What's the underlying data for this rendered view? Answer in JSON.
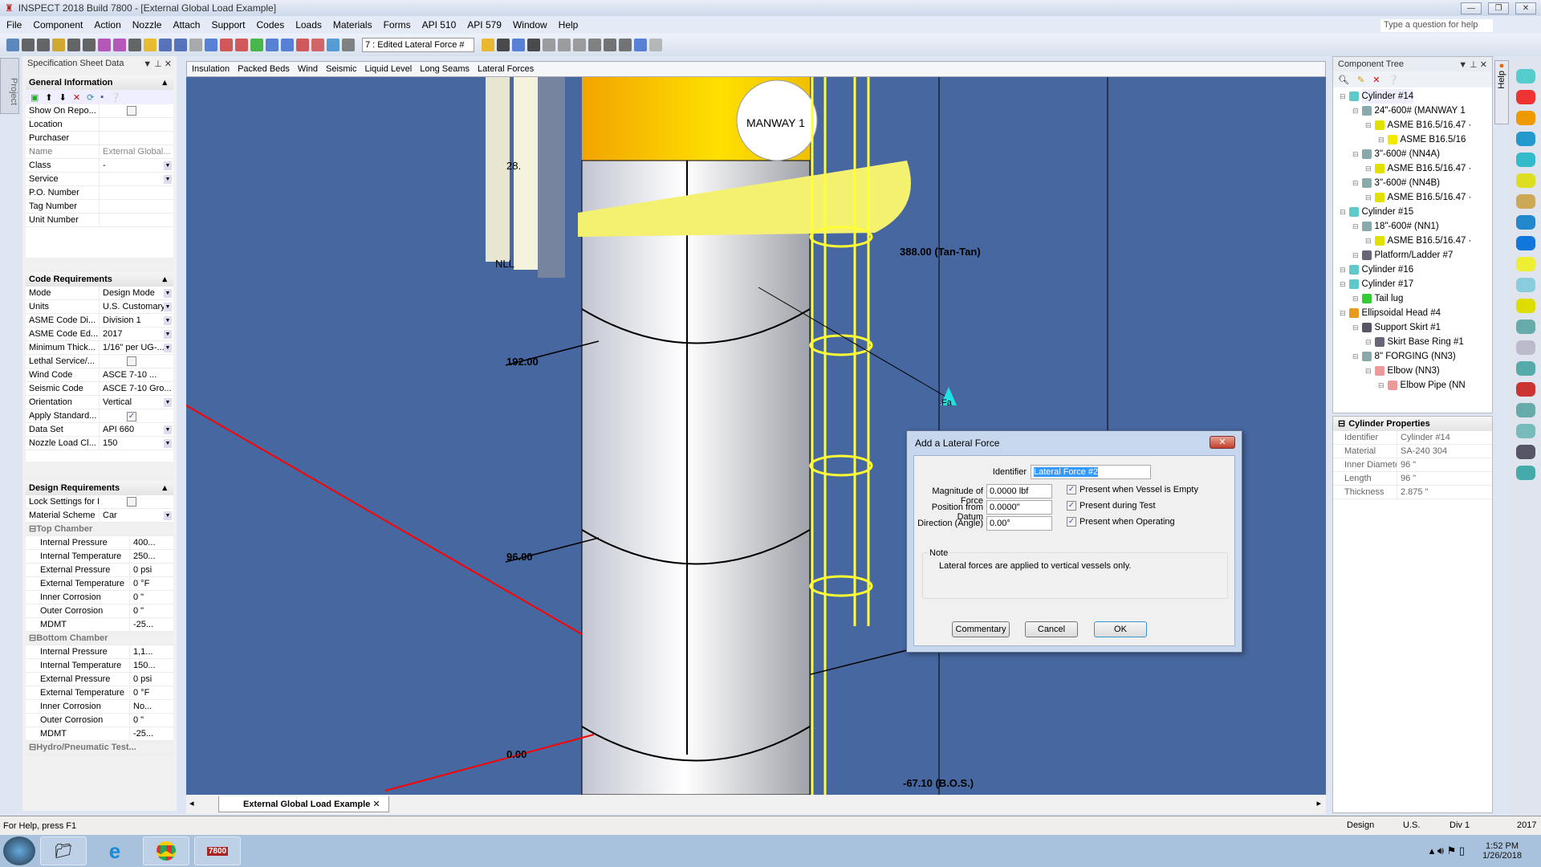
{
  "window": {
    "title": "INSPECT 2018 Build 7800 - [External Global Load Example]",
    "help_placeholder": "Type a question for help"
  },
  "menu": [
    "File",
    "Component",
    "Action",
    "Nozzle",
    "Attach",
    "Support",
    "Codes",
    "Loads",
    "Materials",
    "Forms",
    "API 510",
    "API 579",
    "Window",
    "Help"
  ],
  "toolbar": {
    "history_combo": "7 : Edited Lateral Force #"
  },
  "project_tab": "Project",
  "spec_panel": {
    "title": "Specification Sheet Data",
    "general": {
      "title": "General Information",
      "rows": [
        {
          "k": "Show On Repo...",
          "type": "check",
          "checked": false
        },
        {
          "k": "Location",
          "v": ""
        },
        {
          "k": "Purchaser",
          "v": ""
        },
        {
          "k": "Name",
          "v": "External Global..."
        },
        {
          "k": "Class",
          "v": "-",
          "type": "dd"
        },
        {
          "k": "Service",
          "v": "",
          "type": "dd"
        },
        {
          "k": "P.O. Number",
          "v": ""
        },
        {
          "k": "Tag Number",
          "v": ""
        },
        {
          "k": "Unit Number",
          "v": ""
        }
      ]
    },
    "code": {
      "title": "Code Requirements",
      "rows": [
        {
          "k": "Mode",
          "v": "Design Mode",
          "type": "dd"
        },
        {
          "k": "Units",
          "v": "U.S. Customary",
          "type": "dd"
        },
        {
          "k": "ASME Code Di...",
          "v": "Division 1",
          "type": "dd"
        },
        {
          "k": "ASME Code Ed...",
          "v": "2017",
          "type": "dd"
        },
        {
          "k": "Minimum Thick...",
          "v": "1/16\" per UG-...",
          "type": "dd"
        },
        {
          "k": "Lethal Service/...",
          "type": "check",
          "checked": false
        },
        {
          "k": "Wind Code",
          "v": "ASCE 7-10   ..."
        },
        {
          "k": "Seismic Code",
          "v": "ASCE 7-10 Gro..."
        },
        {
          "k": "Orientation",
          "v": "Vertical",
          "type": "dd"
        },
        {
          "k": "Apply Standard...",
          "type": "check",
          "checked": true
        },
        {
          "k": "Data Set",
          "v": "API 660",
          "type": "dd"
        },
        {
          "k": "Nozzle Load Cl...",
          "v": "150",
          "type": "dd"
        }
      ]
    },
    "design": {
      "title": "Design Requirements",
      "rows": [
        {
          "k": "Lock Settings for Indivi...",
          "type": "check",
          "checked": false
        },
        {
          "k": "Material Scheme",
          "v": "Car",
          "type": "dd"
        },
        {
          "group": "Top Chamber"
        },
        {
          "k": "Internal Pressure",
          "v": "400...",
          "sub": true
        },
        {
          "k": "Internal Temperature",
          "v": "250...",
          "sub": true
        },
        {
          "k": "External Pressure",
          "v": "0 psi",
          "sub": true
        },
        {
          "k": "External Temperature",
          "v": "0 °F",
          "sub": true
        },
        {
          "k": "Inner Corrosion",
          "v": "0 \"",
          "sub": true
        },
        {
          "k": "Outer Corrosion",
          "v": "0 \"",
          "sub": true
        },
        {
          "k": "MDMT",
          "v": "-25...",
          "sub": true
        },
        {
          "group": "Bottom Chamber"
        },
        {
          "k": "Internal Pressure",
          "v": "1,1...",
          "sub": true
        },
        {
          "k": "Internal Temperature",
          "v": "150...",
          "sub": true
        },
        {
          "k": "External Pressure",
          "v": "0 psi",
          "sub": true
        },
        {
          "k": "External Temperature",
          "v": "0 °F",
          "sub": true
        },
        {
          "k": "Inner Corrosion",
          "v": "No...",
          "sub": true
        },
        {
          "k": "Outer Corrosion",
          "v": "0 \"",
          "sub": true
        },
        {
          "k": "MDMT",
          "v": "-25...",
          "sub": true
        },
        {
          "group": "Hydro/Pneumatic Test..."
        }
      ]
    }
  },
  "view_tabs": [
    "Insulation",
    "Packed Beds",
    "Wind",
    "Seismic",
    "Liquid Level",
    "Long Seams",
    "Lateral Forces"
  ],
  "scene_labels": {
    "manway": "MANWAY 1",
    "l28": "28.",
    "nll": "NLL",
    "tan": "388.00  (Tan-Tan)",
    "d192": "192.00",
    "d96": "96.00",
    "d0": "0.00",
    "bos": "-67.10 (B.O.S.)",
    "force": "Fa"
  },
  "doc_tab": "External Global Load Example",
  "component_tree": {
    "title": "Component Tree",
    "items": [
      {
        "label": "Cylinder #14",
        "level": 0,
        "color": "#5fc9c9"
      },
      {
        "label": "24\"-600# (MANWAY 1",
        "level": 1,
        "color": "#8aa"
      },
      {
        "label": "ASME B16.5/16.47 ·",
        "level": 2,
        "color": "#e2e000"
      },
      {
        "label": "ASME B16.5/16",
        "level": 3,
        "color": "#f4ea00"
      },
      {
        "label": "3\"-600# (NN4A)",
        "level": 1,
        "color": "#8aa"
      },
      {
        "label": "ASME B16.5/16.47 ·",
        "level": 2,
        "color": "#e2e000"
      },
      {
        "label": "3\"-600# (NN4B)",
        "level": 1,
        "color": "#8aa"
      },
      {
        "label": "ASME B16.5/16.47 ·",
        "level": 2,
        "color": "#e2e000"
      },
      {
        "label": "Cylinder #15",
        "level": 0,
        "color": "#5fc9c9"
      },
      {
        "label": "18\"-600# (NN1)",
        "level": 1,
        "color": "#8aa"
      },
      {
        "label": "ASME B16.5/16.47 ·",
        "level": 2,
        "color": "#e2e000"
      },
      {
        "label": "Platform/Ladder #7",
        "level": 1,
        "color": "#667"
      },
      {
        "label": "Cylinder #16",
        "level": 0,
        "color": "#5fc9c9"
      },
      {
        "label": "Cylinder #17",
        "level": 0,
        "color": "#5fc9c9"
      },
      {
        "label": "Tail lug",
        "level": 1,
        "color": "#3c3"
      },
      {
        "label": "Ellipsoidal Head #4",
        "level": 0,
        "color": "#e89a20"
      },
      {
        "label": "Support Skirt #1",
        "level": 1,
        "color": "#556"
      },
      {
        "label": "Skirt Base Ring #1",
        "level": 2,
        "color": "#667"
      },
      {
        "label": "8\" FORGING (NN3)",
        "level": 1,
        "color": "#8aa"
      },
      {
        "label": "Elbow (NN3)",
        "level": 2,
        "color": "#e99"
      },
      {
        "label": "Elbow Pipe (NN",
        "level": 3,
        "color": "#e99"
      }
    ]
  },
  "properties": {
    "title": "Cylinder Properties",
    "rows": [
      {
        "k": "Identifier",
        "v": "Cylinder #14"
      },
      {
        "k": "Material",
        "v": "SA-240 304"
      },
      {
        "k": "Inner Diameter",
        "v": "96 \""
      },
      {
        "k": "Length",
        "v": "96 \""
      },
      {
        "k": "Thickness",
        "v": "2.875 \""
      }
    ]
  },
  "help_tab": "Help",
  "dialog": {
    "title": "Add a Lateral Force",
    "identifier_label": "Identifier",
    "identifier": "Lateral Force #2",
    "magnitude_label": "Magnitude of Force",
    "magnitude": "0.0000 lbf",
    "position_label": "Position from Datum",
    "position": "0.0000\"",
    "direction_label": "Direction (Angle)",
    "direction": "0.00°",
    "checks": [
      {
        "label": "Present when Vessel is Empty",
        "checked": true
      },
      {
        "label": "Present during Test",
        "checked": true
      },
      {
        "label": "Present when Operating",
        "checked": true
      }
    ],
    "note_title": "Note",
    "note": "Lateral forces are applied to vertical vessels only.",
    "commentary": "Commentary",
    "cancel": "Cancel",
    "ok": "OK"
  },
  "status": {
    "help": "For Help, press F1",
    "mode": "Design",
    "units": "U.S.",
    "division": "Div 1",
    "edition": "2017"
  },
  "taskbar": {
    "time": "1:52 PM",
    "date": "1/26/2018",
    "app_badge": "7800"
  }
}
